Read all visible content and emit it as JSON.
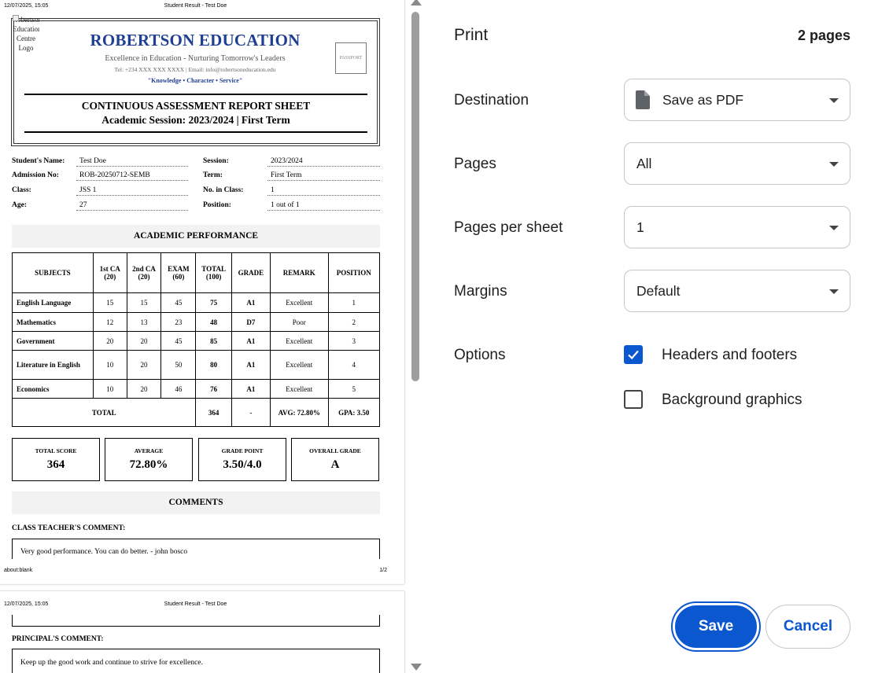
{
  "preview": {
    "page1": {
      "header_date": "12/07/2025, 15:05",
      "header_title": "Student Result - Test Doe",
      "footer_url": "about:blank",
      "footer_page": "1/2"
    },
    "page2": {
      "header_date": "12/07/2025, 15:05",
      "header_title": "Student Result - Test Doe"
    }
  },
  "school": {
    "logo_alt": "Robertson Education Centre Logo",
    "name": "ROBERTSON EDUCATION",
    "tagline": "Excellence in Education - Nurturing Tomorrow's Leaders",
    "contact": "Tel: +234 XXX XXX XXXX | Email: info@robertsoneducation.edu",
    "motto": "\"Knowledge • Character • Service\"",
    "passport_label": "PASSPORT",
    "report_title": "CONTINUOUS ASSESSMENT REPORT SHEET",
    "report_session": "Academic Session: 2023/2024 | First Term"
  },
  "student": {
    "name_label": "Student's Name:",
    "name": "Test Doe",
    "admission_label": "Admission No:",
    "admission": "ROB-20250712-SEMB",
    "class_label": "Class:",
    "class": "JSS 1",
    "age_label": "Age:",
    "age": "27",
    "session_label": "Session:",
    "session": "2023/2024",
    "term_label": "Term:",
    "term": "First Term",
    "no_in_class_label": "No. in Class:",
    "no_in_class": "1",
    "position_label": "Position:",
    "position": "1 out of 1"
  },
  "academic": {
    "section_title": "ACADEMIC PERFORMANCE",
    "headers": [
      "SUBJECTS",
      "1st CA (20)",
      "2nd CA (20)",
      "EXAM (60)",
      "TOTAL (100)",
      "GRADE",
      "REMARK",
      "POSITION"
    ],
    "rows": [
      {
        "subject": "English Language",
        "ca1": "15",
        "ca2": "15",
        "exam": "45",
        "total": "75",
        "grade": "A1",
        "remark": "Excellent",
        "position": "1"
      },
      {
        "subject": "Mathematics",
        "ca1": "12",
        "ca2": "13",
        "exam": "23",
        "total": "48",
        "grade": "D7",
        "remark": "Poor",
        "position": "2"
      },
      {
        "subject": "Government",
        "ca1": "20",
        "ca2": "20",
        "exam": "45",
        "total": "85",
        "grade": "A1",
        "remark": "Excellent",
        "position": "3"
      },
      {
        "subject": "Literature in English",
        "ca1": "10",
        "ca2": "20",
        "exam": "50",
        "total": "80",
        "grade": "A1",
        "remark": "Excellent",
        "position": "4"
      },
      {
        "subject": "Economics",
        "ca1": "10",
        "ca2": "20",
        "exam": "46",
        "total": "76",
        "grade": "A1",
        "remark": "Excellent",
        "position": "5"
      }
    ],
    "total_label": "TOTAL",
    "total_score": "364",
    "total_grade": "-",
    "avg_cell": "AVG: 72.80%",
    "gpa_cell": "GPA: 3.50"
  },
  "summary": [
    {
      "label": "TOTAL SCORE",
      "value": "364"
    },
    {
      "label": "AVERAGE",
      "value": "72.80%"
    },
    {
      "label": "GRADE POINT",
      "value": "3.50/4.0"
    },
    {
      "label": "OVERALL GRADE",
      "value": "A"
    }
  ],
  "comments": {
    "section_title": "COMMENTS",
    "teacher_label": "CLASS TEACHER'S COMMENT:",
    "teacher_comment": "Very good performance. You can do better. - john bosco",
    "principal_label": "PRINCIPAL'S COMMENT:",
    "principal_comment": "Keep up the good work and continue to strive for excellence."
  },
  "print_panel": {
    "title": "Print",
    "page_count": "2 pages",
    "destination_label": "Destination",
    "destination_value": "Save as PDF",
    "pages_label": "Pages",
    "pages_value": "All",
    "pages_per_sheet_label": "Pages per sheet",
    "pages_per_sheet_value": "1",
    "margins_label": "Margins",
    "margins_value": "Default",
    "options_label": "Options",
    "headers_footers_label": "Headers and footers",
    "headers_footers_checked": true,
    "background_graphics_label": "Background graphics",
    "background_graphics_checked": false,
    "save_label": "Save",
    "cancel_label": "Cancel",
    "accent_color": "#0b57d0"
  }
}
